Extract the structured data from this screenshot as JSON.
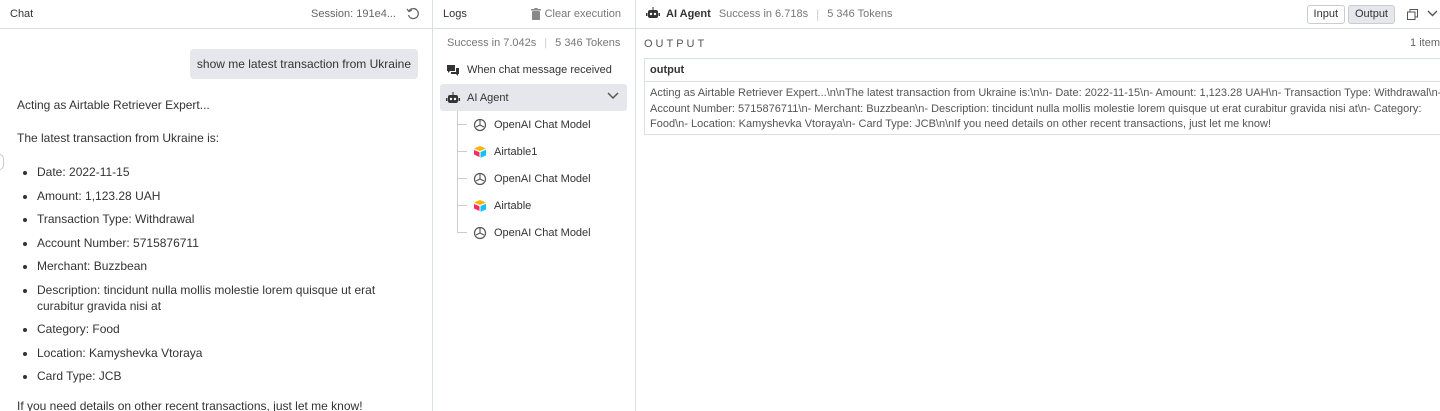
{
  "chat": {
    "title": "Chat",
    "session": "Session: 191e4...",
    "user_message": "show me latest transaction from Ukraine",
    "bot": {
      "intro": "Acting as Airtable Retriever Expert...",
      "lead": "The latest transaction from Ukraine is:",
      "items": [
        "Date: 2022-11-15",
        "Amount: 1,123.28 UAH",
        "Transaction Type: Withdrawal",
        "Account Number: 5715876711",
        "Merchant: Buzzbean",
        "Description: tincidunt nulla mollis molestie lorem quisque ut erat curabitur gravida nisi at",
        "Category: Food",
        "Location: Kamyshevka Vtoraya",
        "Card Type: JCB"
      ],
      "outro": "If you need details on other recent transactions, just let me know!"
    }
  },
  "logs": {
    "title": "Logs",
    "clear_label": "Clear execution",
    "status": "Success in 7.042s",
    "tokens": "5 346 Tokens",
    "tree": [
      {
        "label": "When chat message received",
        "icon": "chat-icon"
      },
      {
        "label": "AI Agent",
        "icon": "robot-icon"
      },
      {
        "label": "OpenAI Chat Model",
        "icon": "openai-icon"
      },
      {
        "label": "Airtable1",
        "icon": "airtable-icon"
      },
      {
        "label": "OpenAI Chat Model",
        "icon": "openai-icon"
      },
      {
        "label": "Airtable",
        "icon": "airtable-icon"
      },
      {
        "label": "OpenAI Chat Model",
        "icon": "openai-icon"
      }
    ]
  },
  "agent": {
    "name": "AI Agent",
    "status": "Success in 6.718s",
    "tokens": "5 346 Tokens",
    "input_label": "Input",
    "output_label": "Output",
    "section_label": "OUTPUT",
    "items_count": "1 item",
    "column": "output",
    "value": "Acting as Airtable Retriever Expert...\\n\\nThe latest transaction from Ukraine is:\\n\\n- Date: 2022-11-15\\n- Amount: 1,123.28 UAH\\n- Transaction Type: Withdrawal\\n- Account Number: 5715876711\\n- Merchant: Buzzbean\\n- Description: tincidunt nulla mollis molestie lorem quisque ut erat curabitur gravida nisi at\\n- Category: Food\\n- Location: Kamyshevka Vtoraya\\n- Card Type: JCB\\n\\nIf you need details on other recent transactions, just let me know!"
  },
  "colors": {
    "border": "#dbdfe7",
    "selected": "#e6e7ec",
    "muted": "#777777"
  }
}
